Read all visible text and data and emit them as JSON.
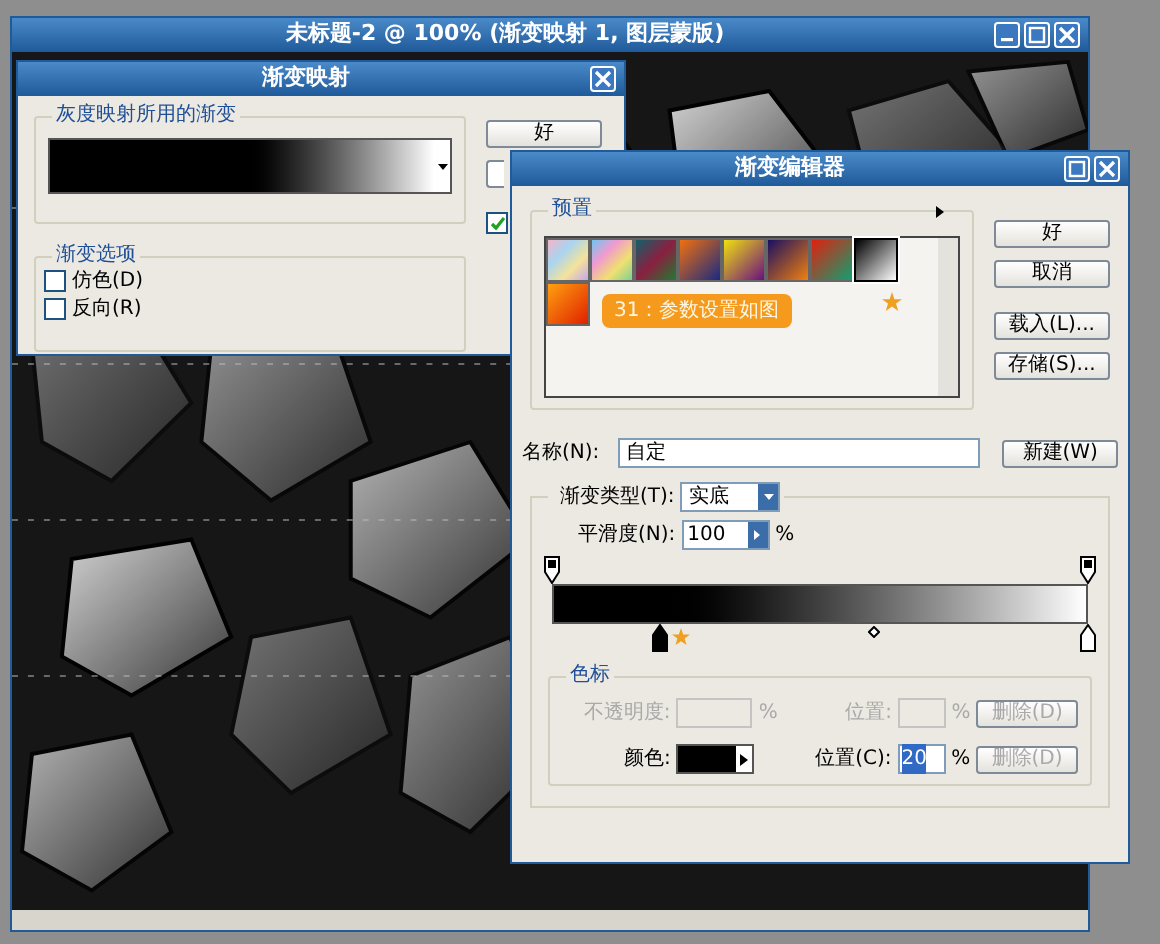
{
  "document_window": {
    "title": "未标题-2 @ 100% (渐变映射 1, 图层蒙版)"
  },
  "gradient_map": {
    "title": "渐变映射",
    "gradient_group": "灰度映射所用的渐变",
    "options_group": "渐变选项",
    "options": [
      {
        "label": "仿色(D)",
        "checked": false
      },
      {
        "label": "反向(R)",
        "checked": false
      }
    ],
    "ok_button": "好",
    "preview_checked": true
  },
  "gradient_editor": {
    "title": "渐变编辑器",
    "presets_group": "预置",
    "presets": [
      {
        "selected": false
      },
      {
        "selected": false
      },
      {
        "selected": false
      },
      {
        "selected": false
      },
      {
        "selected": false
      },
      {
        "selected": false
      },
      {
        "selected": false
      },
      {
        "selected": true
      },
      {
        "selected": false
      }
    ],
    "callout": "31：参数设置如图",
    "buttons": [
      "好",
      "取消",
      "载入(L)...",
      "存储(S)..."
    ],
    "name_label": "名称(N):",
    "name_value": "自定",
    "new_button": "新建(W)",
    "type_label": "渐变类型(T):",
    "type_value": "实底",
    "smooth_label": "平滑度(N):",
    "smooth_value": "100",
    "smooth_unit": "%",
    "opacity_stops": [
      {
        "level": 0
      },
      {
        "level": 1
      }
    ],
    "color_stops": [
      {
        "level": 0.2,
        "selected": true,
        "color": "#000000"
      },
      {
        "level": 1,
        "selected": false,
        "color": "#ffffff"
      }
    ],
    "midpoint": {
      "level": 0.6
    },
    "stops_group": "色标",
    "opacity_row": {
      "disabled": true,
      "label": "不透明度:",
      "unit": "%",
      "location_label": "位置:",
      "location_unit": "%",
      "delete_button": "删除(D)"
    },
    "color_row": {
      "label": "颜色:",
      "location_label": "位置(C):",
      "location_value": "20",
      "unit": "%",
      "delete_button": "删除(D)",
      "delete_disabled": true
    }
  }
}
